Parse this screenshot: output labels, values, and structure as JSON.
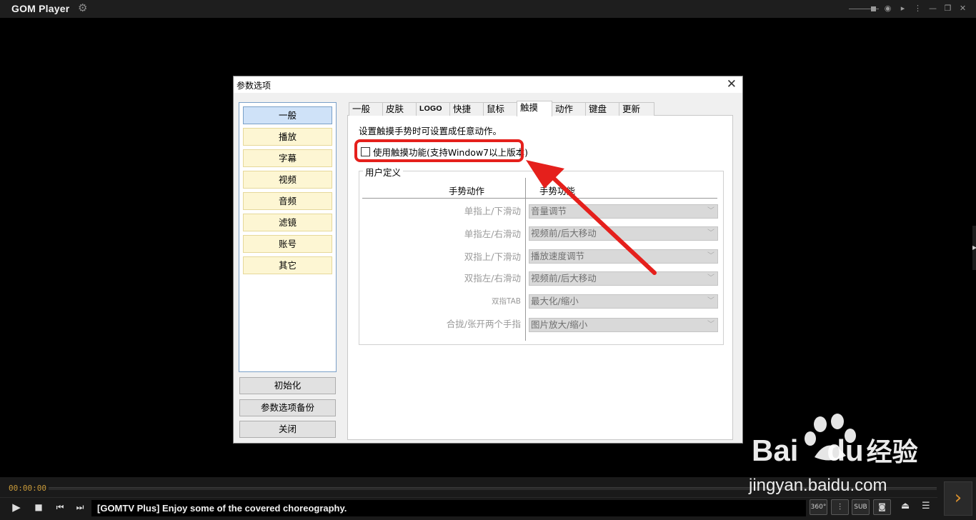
{
  "app": {
    "title": "GOM Player",
    "settings_icon": "gear-icon"
  },
  "window_controls": [
    "volume-slider",
    "broadcast-icon",
    "pip-icon",
    "menu-icon",
    "minimize-icon",
    "maximize-icon",
    "close-icon"
  ],
  "dialog": {
    "title": "参数选项",
    "categories": [
      {
        "label": "一般",
        "selected": true
      },
      {
        "label": "播放"
      },
      {
        "label": "字幕"
      },
      {
        "label": "视频"
      },
      {
        "label": "音频"
      },
      {
        "label": "滤镜"
      },
      {
        "label": "账号"
      },
      {
        "label": "其它"
      }
    ],
    "buttons": {
      "reset": "初始化",
      "backup": "参数选项备份",
      "close": "关闭"
    },
    "tabs": [
      {
        "label": "一般"
      },
      {
        "label": "皮肤"
      },
      {
        "label": "LOGO"
      },
      {
        "label": "快捷"
      },
      {
        "label": "鼠标"
      },
      {
        "label": "触摸",
        "active": true
      },
      {
        "label": "动作"
      },
      {
        "label": "键盘"
      },
      {
        "label": "更新"
      }
    ],
    "touch": {
      "description": "设置触摸手势时可设置成任意动作。",
      "enable_label": "使用触摸功能(支持Window7以上版本)",
      "enable_checked": false,
      "group_title": "用户定义",
      "col_gesture": "手势动作",
      "col_function": "手势功能",
      "rows": [
        {
          "gesture": "单指上/下滑动",
          "function": "音量调节"
        },
        {
          "gesture": "单指左/右滑动",
          "function": "视频前/后大移动"
        },
        {
          "gesture": "双指上/下滑动",
          "function": "播放速度调节"
        },
        {
          "gesture": "双指左/右滑动",
          "function": "视频前/后大移动"
        },
        {
          "gesture": "双指TAB",
          "function": "最大化/缩小"
        },
        {
          "gesture": "合拢/张开两个手指",
          "function": "图片放大/缩小"
        }
      ]
    }
  },
  "annotation": {
    "highlight_color": "#e5201c"
  },
  "player": {
    "time": "00:00:00",
    "ticker": "[GOMTV Plus] Enjoy some of the covered choreography.",
    "buttons": {
      "vr": "360°",
      "sub": "SUB"
    }
  },
  "watermark": {
    "brand": "Bai",
    "brand_suffix": "du",
    "cn": "经验",
    "url": "jingyan.baidu.com"
  },
  "colors": {
    "accent": "#c89a3a",
    "category_bg": "#fdf6d3",
    "category_selected_bg": "#cfe2f8"
  }
}
